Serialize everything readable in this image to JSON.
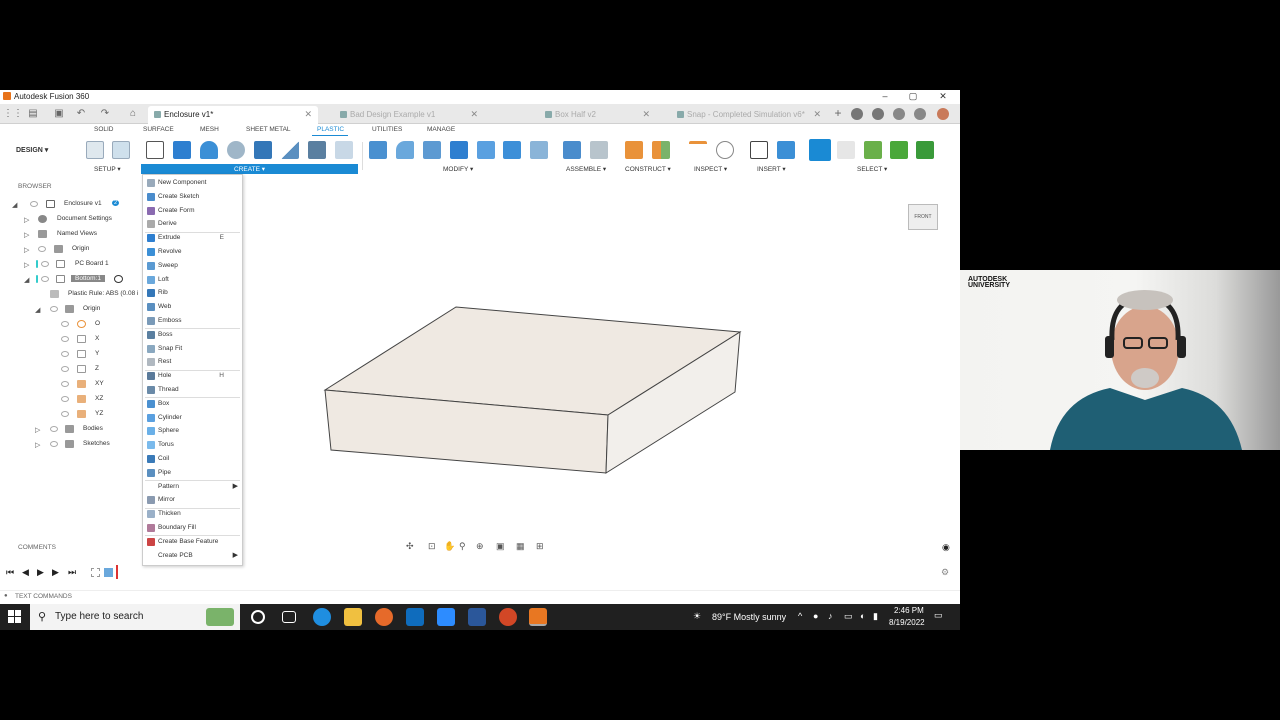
{
  "window": {
    "title": "Autodesk Fusion 360",
    "controls": {
      "minimize": "–",
      "maximize": "▢",
      "close": "✕"
    }
  },
  "doc_tabs": [
    {
      "label": "Enclosure v1*",
      "active": true
    },
    {
      "label": "Bad Design Example v1",
      "active": false
    },
    {
      "label": "Box Half v2",
      "active": false
    },
    {
      "label": "Snap - Completed Simulation v6*",
      "active": false
    }
  ],
  "ribbon_tabs": [
    "SOLID",
    "SURFACE",
    "MESH",
    "SHEET METAL",
    "PLASTIC",
    "UTILITIES",
    "MANAGE"
  ],
  "active_ribbon_tab": "PLASTIC",
  "workspace": "DESIGN ▾",
  "toolbar_groups": {
    "setup": "SETUP ▾",
    "create": "CREATE ▾",
    "modify": "MODIFY ▾",
    "assemble": "ASSEMBLE ▾",
    "construct": "CONSTRUCT ▾",
    "inspect": "INSPECT ▾",
    "insert": "INSERT ▾",
    "select": "SELECT ▾"
  },
  "browser": {
    "header": "BROWSER",
    "items": [
      {
        "label": "Enclosure v1",
        "badge": "2"
      },
      {
        "label": "Document Settings"
      },
      {
        "label": "Named Views"
      },
      {
        "label": "Origin"
      },
      {
        "label": "PC Board 1"
      },
      {
        "label": "Bottom:1"
      },
      {
        "label": "Plastic Rule: ABS (0.08 i"
      },
      {
        "label": "Origin"
      },
      {
        "label": "O"
      },
      {
        "label": "X"
      },
      {
        "label": "Y"
      },
      {
        "label": "Z"
      },
      {
        "label": "XY"
      },
      {
        "label": "XZ"
      },
      {
        "label": "YZ"
      },
      {
        "label": "Bodies"
      },
      {
        "label": "Sketches"
      }
    ]
  },
  "create_menu": [
    {
      "label": "New Component"
    },
    {
      "label": "Create Sketch"
    },
    {
      "label": "Create Form"
    },
    {
      "label": "Derive"
    },
    {
      "label": "Extrude",
      "key": "E"
    },
    {
      "label": "Revolve"
    },
    {
      "label": "Sweep"
    },
    {
      "label": "Loft"
    },
    {
      "label": "Rib"
    },
    {
      "label": "Web"
    },
    {
      "label": "Emboss"
    },
    {
      "label": "Boss"
    },
    {
      "label": "Snap Fit"
    },
    {
      "label": "Rest"
    },
    {
      "label": "Hole",
      "key": "H"
    },
    {
      "label": "Thread"
    },
    {
      "label": "Box"
    },
    {
      "label": "Cylinder"
    },
    {
      "label": "Sphere"
    },
    {
      "label": "Torus"
    },
    {
      "label": "Coil"
    },
    {
      "label": "Pipe"
    },
    {
      "label": "Pattern",
      "submenu": "▶"
    },
    {
      "label": "Mirror"
    },
    {
      "label": "Thicken"
    },
    {
      "label": "Boundary Fill"
    },
    {
      "label": "Create Base Feature"
    },
    {
      "label": "Create PCB",
      "submenu": "▶"
    }
  ],
  "viewcube_label": "FRONT",
  "comments_label": "COMMENTS",
  "text_commands_label": "TEXT COMMANDS",
  "taskbar": {
    "search_placeholder": "Type here to search",
    "weather": "89°F  Mostly sunny",
    "time": "2:46 PM",
    "date": "8/19/2022"
  },
  "webcam": {
    "logo_line1": "AUTODESK",
    "logo_line2": "UNIVERSITY"
  },
  "colors": {
    "accent": "#1a8ad4",
    "taskbar": "#202020",
    "model_face": "#efe9e2"
  }
}
